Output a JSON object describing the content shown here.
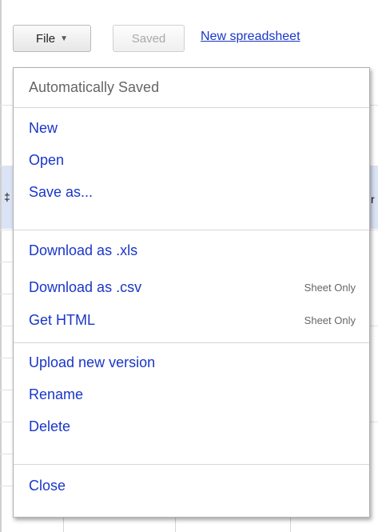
{
  "toolbar": {
    "file_label": "File",
    "saved_label": "Saved",
    "new_spreadsheet_label": "New spreadsheet"
  },
  "menu": {
    "header": "Automatically Saved",
    "groups": [
      [
        {
          "label": "New",
          "note": ""
        },
        {
          "label": "Open",
          "note": ""
        },
        {
          "label": "Save as...",
          "note": ""
        }
      ],
      [
        {
          "label": "Download as .xls",
          "note": ""
        },
        {
          "label": "Download as .csv",
          "note": "Sheet Only"
        },
        {
          "label": "Get HTML",
          "note": "Sheet Only"
        }
      ],
      [
        {
          "label": "Upload new version",
          "note": ""
        },
        {
          "label": "Rename",
          "note": ""
        },
        {
          "label": "Delete",
          "note": ""
        }
      ],
      [
        {
          "label": "Close",
          "note": ""
        }
      ]
    ]
  },
  "colors": {
    "link": "#1a36c8",
    "note": "#666666",
    "separator": "#d6d6d6",
    "selection": "#dbe4f6"
  },
  "icons": {
    "file_caret": "chevron-down-icon"
  }
}
